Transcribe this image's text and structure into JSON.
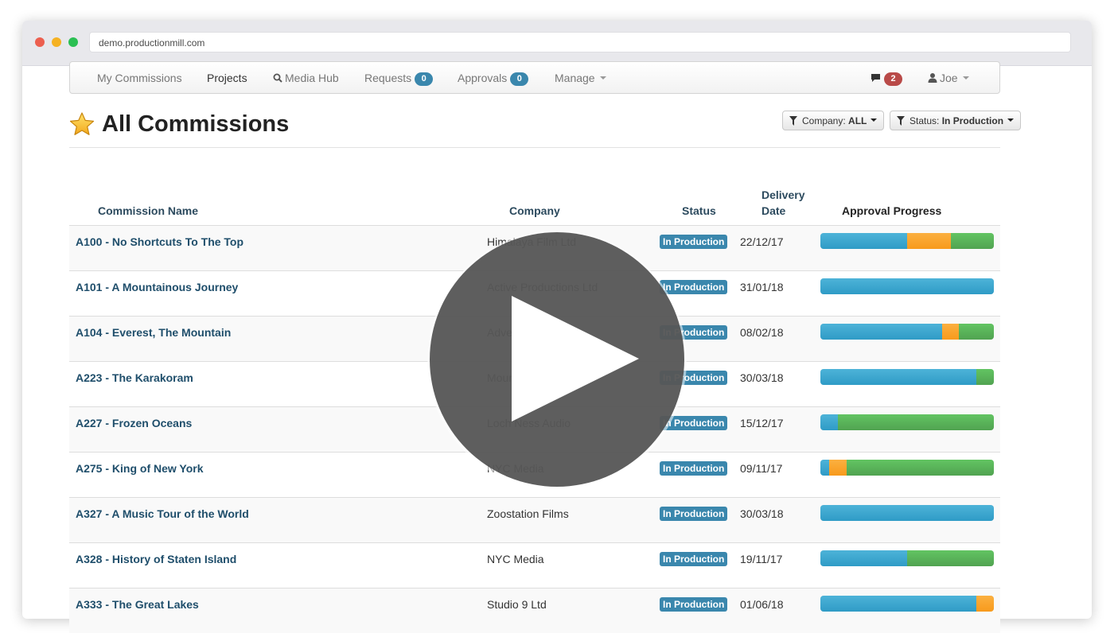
{
  "browser": {
    "url": "demo.productionmill.com"
  },
  "navbar": {
    "my_commissions": "My Commissions",
    "projects": "Projects",
    "media_hub": "Media Hub",
    "requests": "Requests",
    "requests_count": "0",
    "approvals": "Approvals",
    "approvals_count": "0",
    "manage": "Manage",
    "messages_count": "2",
    "user": "Joe"
  },
  "header": {
    "title": "All Commissions",
    "company_filter_label": "Company:",
    "company_filter_value": "ALL",
    "status_filter_label": "Status:",
    "status_filter_value": "In Production"
  },
  "table": {
    "columns": {
      "name": "Commission Name",
      "company": "Company",
      "status": "Status",
      "delivery_line1": "Delivery",
      "delivery_line2": "Date",
      "progress": "Approval Progress"
    },
    "rows": [
      {
        "name": "A100 - No Shortcuts To The Top",
        "company": "Himalaya Film Ltd",
        "status": "In Production",
        "date": "22/12/17",
        "progress": [
          0.5,
          0.25,
          0.25
        ]
      },
      {
        "name": "A101 - A Mountainous Journey",
        "company": "Active Productions Ltd",
        "status": "In Production",
        "date": "31/01/18",
        "progress": [
          1.0,
          0.0,
          0.0
        ]
      },
      {
        "name": "A104 - Everest, The Mountain",
        "company": "Adventure Media",
        "status": "In Production",
        "date": "08/02/18",
        "progress": [
          0.7,
          0.1,
          0.2
        ]
      },
      {
        "name": "A223 - The Karakoram",
        "company": "Mountain Films Ltd",
        "status": "In Production",
        "date": "30/03/18",
        "progress": [
          0.9,
          0.0,
          0.1
        ]
      },
      {
        "name": "A227 - Frozen Oceans",
        "company": "Loch Ness Audio",
        "status": "In Production",
        "date": "15/12/17",
        "progress": [
          0.1,
          0.0,
          0.9
        ]
      },
      {
        "name": "A275 - King of New York",
        "company": "NYC Media",
        "status": "In Production",
        "date": "09/11/17",
        "progress": [
          0.05,
          0.1,
          0.85
        ]
      },
      {
        "name": "A327 - A Music Tour of the World",
        "company": "Zoostation Films",
        "status": "In Production",
        "date": "30/03/18",
        "progress": [
          1.0,
          0.0,
          0.0
        ]
      },
      {
        "name": "A328 - History of Staten Island",
        "company": "NYC Media",
        "status": "In Production",
        "date": "19/11/17",
        "progress": [
          0.5,
          0.0,
          0.5
        ]
      },
      {
        "name": "A333 - The Great Lakes",
        "company": "Studio 9 Ltd",
        "status": "In Production",
        "date": "01/06/18",
        "progress": [
          0.9,
          0.1,
          0.0
        ]
      }
    ]
  },
  "colors": {
    "approved": "#51a351",
    "pending": "#f89a1c",
    "not_started": "#2f9bc6",
    "status_badge": "#3a87ad"
  }
}
